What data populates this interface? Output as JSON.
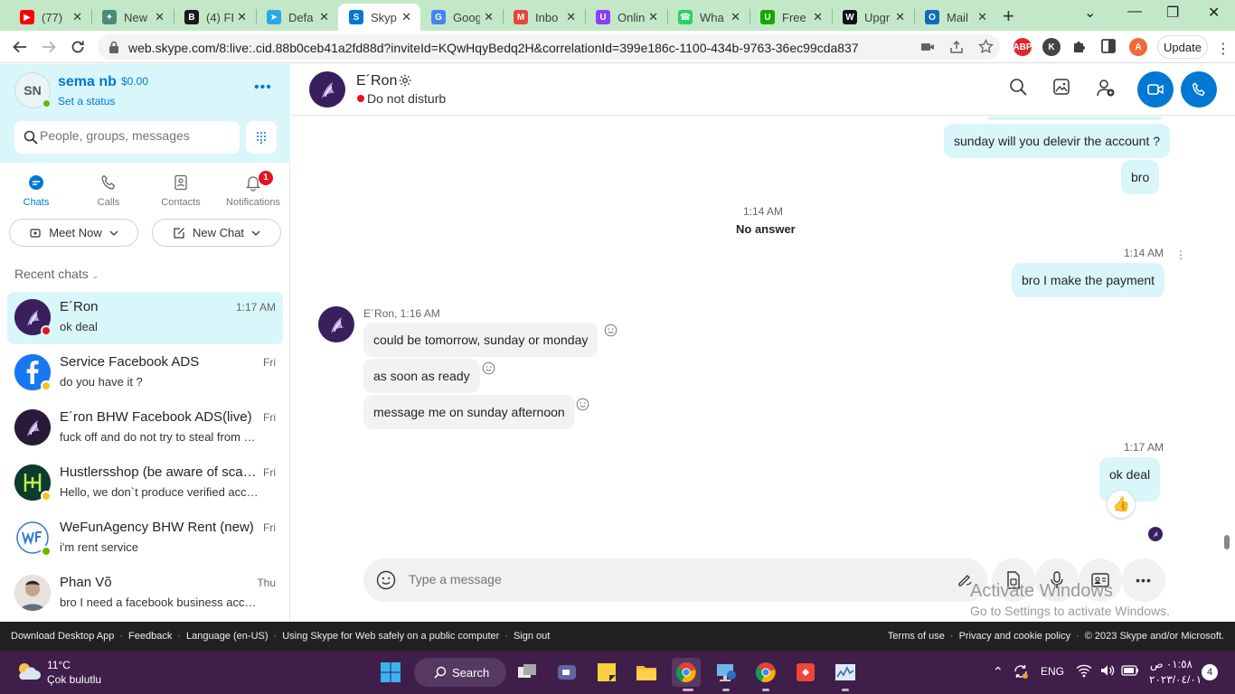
{
  "browser": {
    "tabs": [
      {
        "title": "(77)",
        "favicon": "youtube-icon",
        "color": "#ff0000",
        "glyph": "▶"
      },
      {
        "title": "New",
        "favicon": "chatgpt-icon",
        "color": "#4b8b7a",
        "glyph": "✦"
      },
      {
        "title": "(4) FB",
        "favicon": "bhw-icon",
        "color": "#1a1a1a",
        "glyph": "B"
      },
      {
        "title": "Defa",
        "favicon": "telegram-icon",
        "color": "#29a9eb",
        "glyph": "➤"
      },
      {
        "title": "Skyp",
        "favicon": "skype-icon",
        "color": "#0078d4",
        "glyph": "S"
      },
      {
        "title": "Goog",
        "favicon": "google-translate-icon",
        "color": "#4285f4",
        "glyph": "G"
      },
      {
        "title": "Inbo",
        "favicon": "gmail-icon",
        "color": "#ea4335",
        "glyph": "M"
      },
      {
        "title": "Onlin",
        "favicon": "online-icon",
        "color": "#8a3ffc",
        "glyph": "U"
      },
      {
        "title": "Wha",
        "favicon": "whatsapp-icon",
        "color": "#25d366",
        "glyph": "☎"
      },
      {
        "title": "Free",
        "favicon": "upwork-icon",
        "color": "#14a800",
        "glyph": "U"
      },
      {
        "title": "Upgr",
        "favicon": "wix-icon",
        "color": "#111111",
        "glyph": "W"
      },
      {
        "title": "Mail",
        "favicon": "outlook-icon",
        "color": "#0f6cbd",
        "glyph": "O"
      }
    ],
    "url": "web.skype.com/8:live:.cid.88b0ceb41a2fd88d?inviteId=KQwHqyBedq2H&correlationId=399e186c-1100-434b-9763-36ec99cda837",
    "update_label": "Update",
    "extensions": [
      {
        "name": "adblock-icon",
        "label": "ABP",
        "color": "#e0262b"
      },
      {
        "name": "k-extension-icon",
        "label": "K",
        "color": "#444444"
      },
      {
        "name": "profile-avatar-icon",
        "label": "A",
        "color": "#f06a35"
      }
    ]
  },
  "profile": {
    "initials": "SN",
    "name": "sema nb",
    "credit": "$0.00",
    "status_link": "Set a status"
  },
  "search": {
    "placeholder": "People, groups, messages"
  },
  "nav_tabs": [
    {
      "label": "Chats"
    },
    {
      "label": "Calls"
    },
    {
      "label": "Contacts"
    },
    {
      "label": "Notifications",
      "badge": "1"
    }
  ],
  "actions": {
    "meet_now": "Meet Now",
    "new_chat": "New Chat"
  },
  "recent_label": "Recent chats",
  "chats": [
    {
      "name": "E´Ron",
      "preview": "ok deal",
      "time": "1:17 AM",
      "status": "dnd",
      "avatar_color": "#3a1f5e"
    },
    {
      "name": "Service Facebook ADS",
      "preview": "do you have it ?",
      "time": "Fri",
      "status": "away",
      "avatar_color": "#1877f2"
    },
    {
      "name": "E´ron BHW Facebook ADS(live)",
      "preview": "fuck off and do not try to steal from my clients",
      "time": "Fri",
      "status": "none",
      "avatar_color": "#2a1a3a"
    },
    {
      "name": "Hustlersshop (be aware of scammers)",
      "preview": "Hello, we don`t produce verified accounts",
      "time": "Fri",
      "status": "away",
      "avatar_color": "#0d3b2e"
    },
    {
      "name": "WeFunAgency BHW Rent (new)",
      "preview": "i'm rent service",
      "time": "Fri",
      "status": "online",
      "avatar_color": "#ffffff"
    },
    {
      "name": "Phan Võ",
      "preview": "bro I need a facebook business account",
      "time": "Thu",
      "status": "none",
      "avatar_color": "#c7a38b"
    }
  ],
  "conversation": {
    "name": "E´Ron",
    "status": "Do not disturb",
    "messages": {
      "out1": "sunday will you delevir the account ?",
      "out2": "bro",
      "call_time": "1:14 AM",
      "call_status": "No answer",
      "out3_time": "1:14 AM",
      "out3": "bro I make the payment",
      "in_meta": "E´Ron, 1:16 AM",
      "in1": "could be tomorrow, sunday or monday",
      "in2": "as soon as ready",
      "in3": "message me on sunday afternoon",
      "out4_time": "1:17 AM",
      "out4": "ok deal",
      "reaction": "👍"
    },
    "composer_placeholder": "Type a message"
  },
  "watermark": {
    "line1": "Activate Windows",
    "line2": "Go to Settings to activate Windows."
  },
  "footer": {
    "left": [
      "Download Desktop App",
      "Feedback",
      "Language (en-US)",
      "Using Skype for Web safely on a public computer",
      "Sign out"
    ],
    "right": [
      "Terms of use",
      "Privacy and cookie policy",
      "© 2023 Skype and/or Microsoft."
    ]
  },
  "taskbar": {
    "temperature": "11°C",
    "weather": "Çok bulutlu",
    "search_label": "Search",
    "language": "ENG",
    "time": "٠١:٥٨ ص",
    "date": "٢٠٢٣/٠٤/٠١",
    "notification_count": "4"
  }
}
